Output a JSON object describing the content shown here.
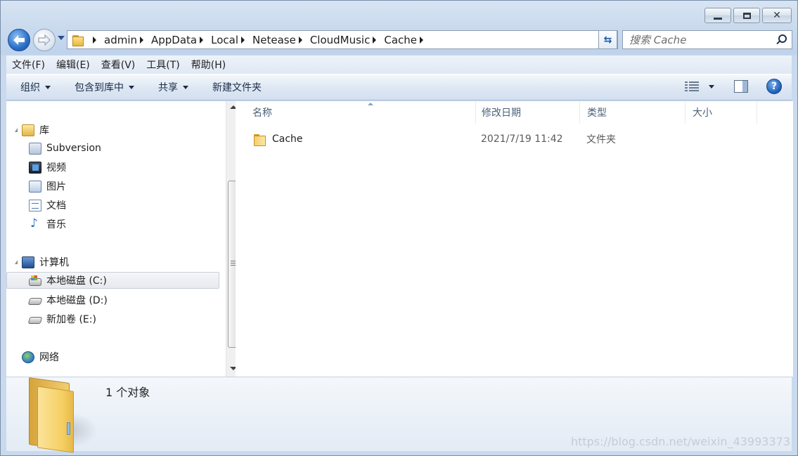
{
  "window": {
    "caption": {
      "minimize_icon": "minimize-icon",
      "maximize_icon": "maximize-icon",
      "close_icon": "close-icon",
      "close_glyph": "✕"
    }
  },
  "nav": {
    "breadcrumbs": [
      "admin",
      "AppData",
      "Local",
      "Netease",
      "CloudMusic",
      "Cache"
    ],
    "search_placeholder": "搜索 Cache"
  },
  "menubar": {
    "items": [
      "文件(F)",
      "编辑(E)",
      "查看(V)",
      "工具(T)",
      "帮助(H)"
    ]
  },
  "cmdbar": {
    "organize": "组织",
    "include_library": "包含到库中",
    "share": "共享",
    "new_folder": "新建文件夹",
    "help_glyph": "?"
  },
  "navpane": {
    "libraries": "库",
    "library_items": [
      "Subversion",
      "视频",
      "图片",
      "文档",
      "音乐"
    ],
    "computer": "计算机",
    "drives": [
      "本地磁盘 (C:)",
      "本地磁盘 (D:)",
      "新加卷 (E:)"
    ],
    "network": "网络"
  },
  "columns": {
    "name": "名称",
    "modified": "修改日期",
    "type": "类型",
    "size": "大小"
  },
  "files": [
    {
      "name": "Cache",
      "modified": "2021/7/19 11:42",
      "type": "文件夹",
      "size": ""
    }
  ],
  "details": {
    "count": "1 个对象"
  },
  "watermark": "https://blog.csdn.net/weixin_43993373"
}
